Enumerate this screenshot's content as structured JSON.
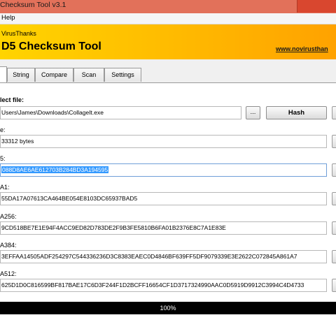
{
  "window": {
    "title": "Checksum Tool v3.1"
  },
  "menu": {
    "help": "Help"
  },
  "banner": {
    "company": "VirusThanks",
    "app_title": "D5 Checksum Tool",
    "website": "www.novirusthan"
  },
  "tabs": [
    {
      "label": ""
    },
    {
      "label": "String"
    },
    {
      "label": "Compare"
    },
    {
      "label": "Scan"
    },
    {
      "label": "Settings"
    }
  ],
  "file": {
    "label": "lect file:",
    "path": "Users\\James\\Downloads\\CollageIt.exe",
    "browse_label": "...",
    "hash_label": "Hash"
  },
  "fields": {
    "size": {
      "label": "e:",
      "value": "33312 bytes"
    },
    "md5": {
      "label": "5:",
      "value": "088D8AE6AE612703B284BD3A194595"
    },
    "sha1": {
      "label": "A1:",
      "value": "55DA17A07613CA464BE054E8103DC65937BAD5"
    },
    "sha256": {
      "label": "A256:",
      "value": "9CD518BE7E1E94F4ACC9ED82D783DE2F9B3FE5810B6FA01B2376E8C7A1E83E"
    },
    "sha384": {
      "label": "A384:",
      "value": "3EFFAA14505ADF254297C544336236D3C8383EAEC0D4846BF639FF5DF9079339E3E2622C072845A861A7"
    },
    "sha512": {
      "label": "A512:",
      "value": "625D1D0C816599BF817BAE17C6D3F244F1D2BCFF16654CF1D3717324990AAC0D5919D9912C3994C4D4733"
    }
  },
  "progress": {
    "text": "100%",
    "value_percent": 100
  },
  "colors": {
    "titlebar": "#e2715a",
    "close": "#d9472f",
    "banner": "#ffbe00",
    "selection": "#3399ff"
  }
}
